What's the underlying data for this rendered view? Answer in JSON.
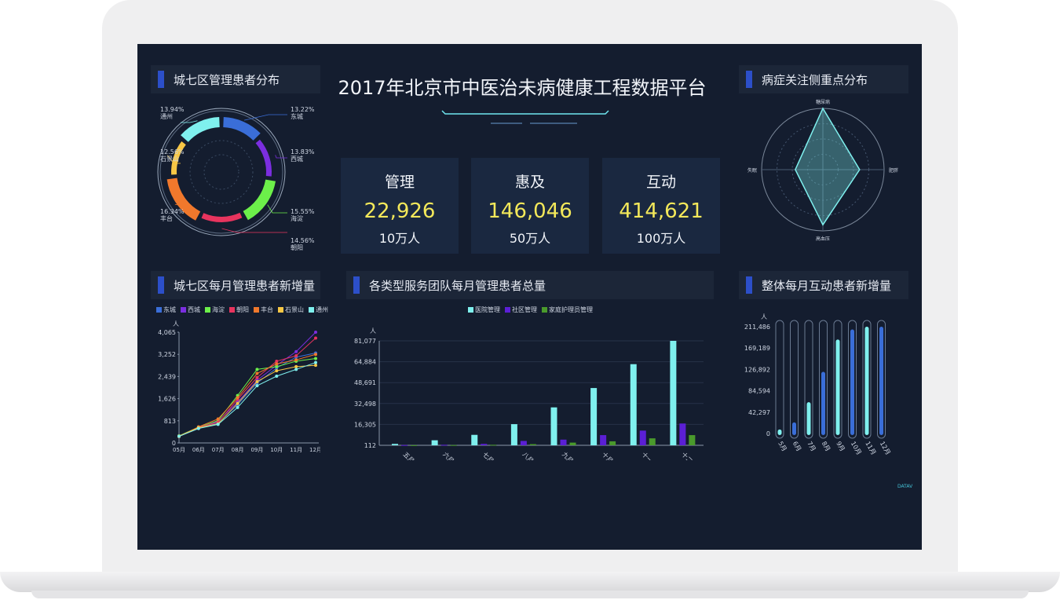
{
  "main_title": "2017年北京市中医治未病健康工程数据平台",
  "stats": [
    {
      "label": "管理",
      "value": "22,926",
      "unit": "10万人"
    },
    {
      "label": "惠及",
      "value": "146,046",
      "unit": "50万人"
    },
    {
      "label": "互动",
      "value": "414,621",
      "unit": "100万人"
    }
  ],
  "panels": {
    "district_dist": "城七区管理患者分布",
    "symptom_focus": "病症关注侧重点分布",
    "district_monthly": "城七区每月管理患者新增量",
    "team_monthly": "各类型服务团队每月管理患者总量",
    "interaction_monthly": "整体每月互动患者新增量"
  },
  "watermark": "DATAV",
  "colors": {
    "accent": "#2c4fc9",
    "highlight": "#f3e85a",
    "bg": "#141d2f"
  },
  "chart_data": [
    {
      "type": "pie",
      "title": "城七区管理患者分布",
      "slices": [
        {
          "name": "东城",
          "value": 13.22,
          "label": "13.22%",
          "color": "#3a6ed8"
        },
        {
          "name": "西城",
          "value": 13.83,
          "label": "13.83%",
          "color": "#7b2ee0"
        },
        {
          "name": "海淀",
          "value": 15.55,
          "label": "15.55%",
          "color": "#6cf04a"
        },
        {
          "name": "朝阳",
          "value": 14.56,
          "label": "14.56%",
          "color": "#e8345e"
        },
        {
          "name": "丰台",
          "value": 16.34,
          "label": "16.34%",
          "color": "#f0782c"
        },
        {
          "name": "石景山",
          "value": 12.56,
          "label": "12.56%",
          "color": "#f7c745"
        },
        {
          "name": "通州",
          "value": 13.94,
          "label": "13.94%",
          "color": "#7ff0ee"
        }
      ]
    },
    {
      "type": "radar",
      "title": "病症关注侧重点分布",
      "axes": [
        "糖尿病",
        "肥胖",
        "高血压",
        "失眠"
      ],
      "values": [
        1.0,
        0.6,
        0.9,
        0.45
      ]
    },
    {
      "type": "line",
      "title": "城七区每月管理患者新增量",
      "ylabel": "人",
      "categories": [
        "05月",
        "06月",
        "07月",
        "08月",
        "09月",
        "10月",
        "11月",
        "12月"
      ],
      "y_ticks": [
        "0",
        "813",
        "1,626",
        "2,439",
        "3,252",
        "4,065"
      ],
      "ylim": [
        0,
        4065
      ],
      "series": [
        {
          "name": "东城",
          "color": "#3a6ed8",
          "values": [
            260,
            560,
            720,
            1400,
            2200,
            2750,
            3150,
            3300
          ]
        },
        {
          "name": "西城",
          "color": "#7b2ee0",
          "values": [
            240,
            540,
            790,
            1500,
            2300,
            2850,
            3350,
            4065
          ]
        },
        {
          "name": "海淀",
          "color": "#6cf04a",
          "values": [
            260,
            580,
            820,
            1740,
            2700,
            2800,
            3000,
            3100
          ]
        },
        {
          "name": "朝阳",
          "color": "#e8345e",
          "values": [
            250,
            570,
            760,
            1600,
            2400,
            3000,
            3200,
            3850
          ]
        },
        {
          "name": "丰台",
          "color": "#f0782c",
          "values": [
            230,
            590,
            880,
            1660,
            2550,
            2900,
            3050,
            3250
          ]
        },
        {
          "name": "石景山",
          "color": "#f7c745",
          "values": [
            250,
            560,
            700,
            1450,
            2250,
            2650,
            2800,
            2850
          ]
        },
        {
          "name": "通州",
          "color": "#7ff0ee",
          "values": [
            240,
            530,
            680,
            1300,
            2100,
            2450,
            2700,
            2950
          ]
        }
      ]
    },
    {
      "type": "bar",
      "title": "各类型服务团队每月管理患者总量",
      "ylabel": "人",
      "categories": [
        "五月",
        "六月",
        "七月",
        "八月",
        "九月",
        "十月",
        "十一月",
        "十二月"
      ],
      "y_ticks": [
        "112",
        "16,305",
        "32,498",
        "48,691",
        "64,884",
        "81,077"
      ],
      "ylim": [
        112,
        81077
      ],
      "series": [
        {
          "name": "医院管理",
          "color": "#7ff0ee",
          "values": [
            1200,
            4000,
            8200,
            16500,
            29500,
            44500,
            63000,
            81077
          ]
        },
        {
          "name": "社区管理",
          "color": "#5b1fd6",
          "values": [
            300,
            500,
            1200,
            3500,
            4500,
            8000,
            11500,
            17000
          ]
        },
        {
          "name": "家庭护理员管理",
          "color": "#4a9a2c",
          "values": [
            200,
            300,
            500,
            1000,
            2200,
            3200,
            5500,
            8000
          ]
        }
      ]
    },
    {
      "type": "bar",
      "title": "整体每月互动患者新增量",
      "ylabel": "人",
      "categories": [
        "5月",
        "6月",
        "7月",
        "8月",
        "9月",
        "10月",
        "11月",
        "12月"
      ],
      "y_ticks": [
        "0",
        "42,297",
        "84,594",
        "126,892",
        "169,189",
        "211,486"
      ],
      "ylim": [
        0,
        211486
      ],
      "values": [
        8000,
        22000,
        62000,
        122000,
        186000,
        206000,
        211486,
        211486
      ],
      "colors": [
        "#7ff0ee",
        "#3a6ed8"
      ]
    }
  ]
}
